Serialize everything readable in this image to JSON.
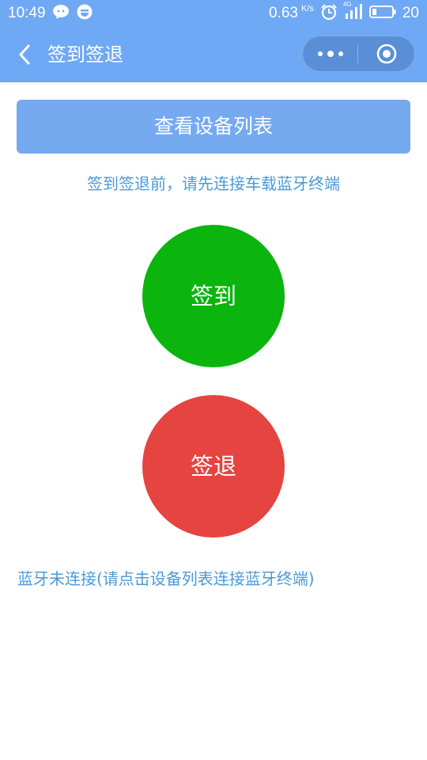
{
  "status_bar": {
    "time": "10:49",
    "speed": "0.63",
    "speed_unit": "K/s",
    "network": "4G",
    "battery": "20",
    "icons": [
      "wechat-icon",
      "sync-icon",
      "alarm-icon",
      "signal-icon",
      "battery-icon"
    ]
  },
  "nav": {
    "title": "签到签退",
    "back_icon": "chevron-left-icon",
    "more_icon": "more-dots-icon",
    "close_icon": "target-close-icon"
  },
  "main": {
    "device_list_button": "查看设备列表",
    "hint": "签到签退前，请先连接车载蓝牙终端",
    "checkin_label": "签到",
    "checkout_label": "签退",
    "status": "蓝牙未连接(请点击设备列表连接蓝牙终端)"
  },
  "colors": {
    "header": "#6fa8f4",
    "button": "#76aaf0",
    "checkin": "#0bb50e",
    "checkout": "#e54441",
    "link_text": "#4a9ad8"
  }
}
